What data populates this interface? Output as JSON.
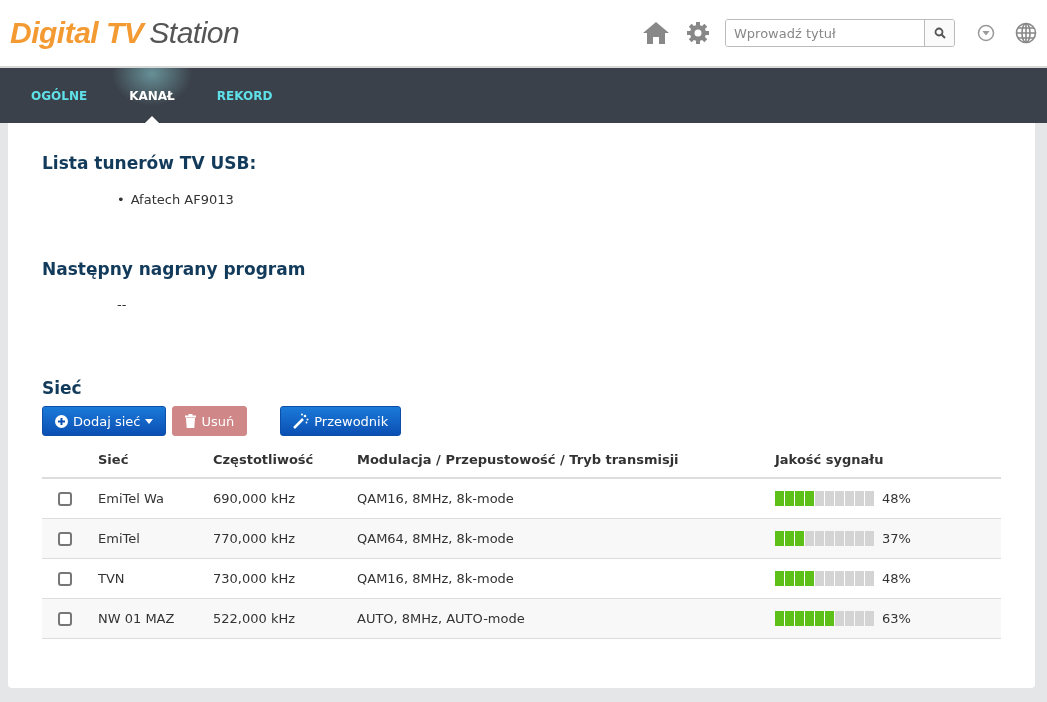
{
  "logo": {
    "brand": "Digital TV",
    "suffix": "Station"
  },
  "search": {
    "placeholder": "Wprowadź tytuł"
  },
  "tabs": [
    {
      "label": "OGÓLNE",
      "selected": false
    },
    {
      "label": "KANAŁ",
      "selected": true
    },
    {
      "label": "REKORD",
      "selected": false
    }
  ],
  "tuners": {
    "title": "Lista tunerów TV USB:",
    "bullet": "•",
    "items": [
      "Afatech AF9013"
    ]
  },
  "next_recording": {
    "title": "Następny nagrany program",
    "value": "--"
  },
  "network": {
    "title": "Sieć",
    "buttons": [
      {
        "kind": "add",
        "label": "Dodaj sieć",
        "disabled": false
      },
      {
        "kind": "delete",
        "label": "Usuń",
        "disabled": true
      },
      {
        "kind": "wizard",
        "label": "Przewodnik",
        "disabled": false
      }
    ],
    "columns": [
      "Sieć",
      "Częstotliwość",
      "Modulacja / Przepustowość / Tryb transmisji",
      "Jakość sygnału"
    ],
    "rows": [
      {
        "checked": false,
        "name": "EmiTel Wa",
        "frequency": "690,000 kHz",
        "modulation": "QAM16, 8MHz, 8k-mode",
        "level": 0.4,
        "reading": "48%"
      },
      {
        "checked": false,
        "name": "EmiTel",
        "frequency": "770,000 kHz",
        "modulation": "QAM64, 8MHz, 8k-mode",
        "level": 0.3,
        "reading": "37%"
      },
      {
        "checked": false,
        "name": "TVN",
        "frequency": "730,000 kHz",
        "modulation": "QAM16, 8MHz, 8k-mode",
        "level": 0.4,
        "reading": "48%"
      },
      {
        "checked": false,
        "name": "NW 01 MAZ",
        "frequency": "522,000 kHz",
        "modulation": "AUTO, 8MHz, AUTO-mode",
        "level": 0.6,
        "reading": "63%"
      }
    ]
  }
}
